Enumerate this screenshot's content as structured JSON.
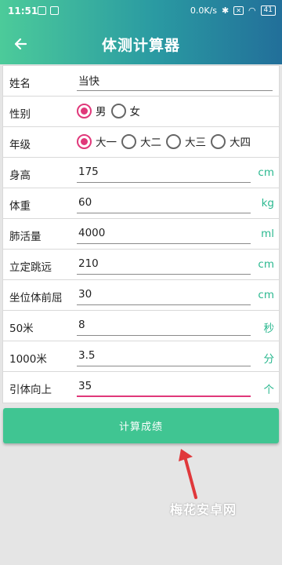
{
  "statusbar": {
    "time": "11:51",
    "speed": "0.0K/s",
    "battery": "41"
  },
  "appbar": {
    "title": "体测计算器"
  },
  "form": {
    "name": {
      "label": "姓名",
      "value": "当快"
    },
    "gender": {
      "label": "性别",
      "options": [
        "男",
        "女"
      ],
      "selected": "男"
    },
    "grade": {
      "label": "年级",
      "options": [
        "大一",
        "大二",
        "大三",
        "大四"
      ],
      "selected": "大一"
    },
    "height": {
      "label": "身高",
      "value": "175",
      "unit": "cm"
    },
    "weight": {
      "label": "体重",
      "value": "60",
      "unit": "kg"
    },
    "lung": {
      "label": "肺活量",
      "value": "4000",
      "unit": "ml"
    },
    "jump": {
      "label": "立定跳远",
      "value": "210",
      "unit": "cm"
    },
    "reach": {
      "label": "坐位体前屈",
      "value": "30",
      "unit": "cm"
    },
    "run50": {
      "label": "50米",
      "value": "8",
      "unit": "秒"
    },
    "run1000": {
      "label": "1000米",
      "value": "3.5",
      "unit": "分"
    },
    "pullup": {
      "label": "引体向上",
      "value": "35",
      "unit": "个"
    }
  },
  "calc_button": {
    "label": "计算成绩"
  },
  "watermark": "梅花安卓网",
  "colors": {
    "accent": "#40c592",
    "radio": "#e0387a",
    "unit": "#2ab88f"
  }
}
